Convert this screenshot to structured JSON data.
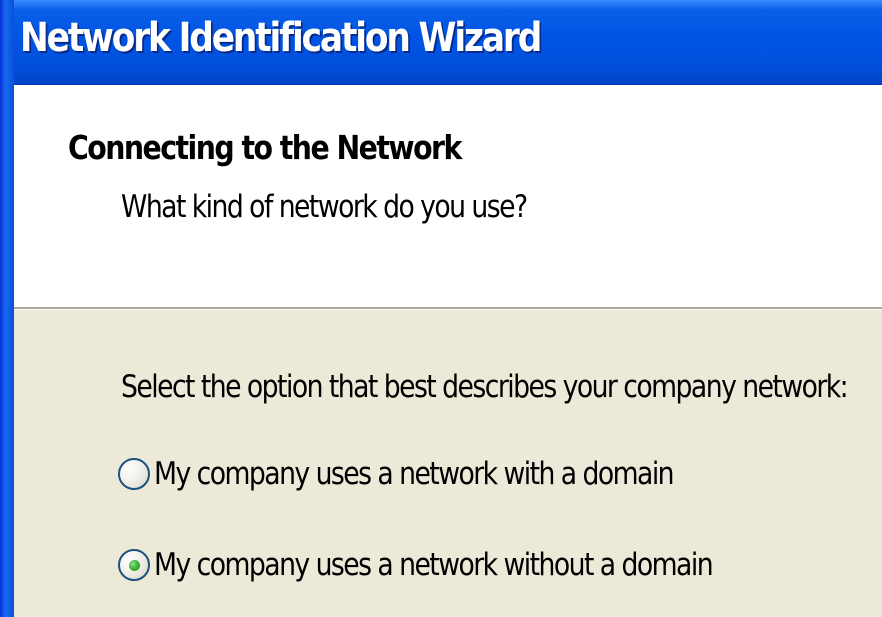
{
  "window": {
    "title": "Network Identification Wizard"
  },
  "header": {
    "title": "Connecting to the Network",
    "subtitle": "What kind of network do you use?"
  },
  "body": {
    "prompt": "Select the option that best describes your company network:",
    "options": [
      {
        "label": "My company uses a network with a domain",
        "selected": false
      },
      {
        "label": "My company uses a network without a domain",
        "selected": true
      }
    ]
  },
  "colors": {
    "title_bar": "#0054e3",
    "header_background": "#ffffff",
    "body_background": "#ece9d8",
    "radio_selected_dot": "#3fb83a"
  }
}
